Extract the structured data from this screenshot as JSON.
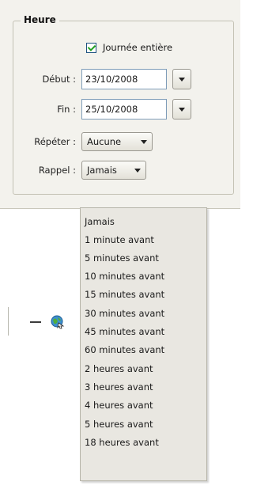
{
  "section": {
    "title": "Heure"
  },
  "all_day": {
    "label": "Journée entière",
    "checked": true
  },
  "start": {
    "label": "Début :",
    "value": "23/10/2008"
  },
  "end": {
    "label": "Fin :",
    "value": "25/10/2008"
  },
  "repeat": {
    "label": "Répéter :",
    "value": "Aucune"
  },
  "reminder": {
    "label": "Rappel :",
    "value": "Jamais",
    "options": [
      "Jamais",
      "1 minute avant",
      "5 minutes avant",
      "10 minutes avant",
      "15 minutes avant",
      "30 minutes avant",
      "45 minutes avant",
      "60 minutes avant",
      "2 heures avant",
      "3 heures avant",
      "4 heures avant",
      "5 heures avant",
      "18 heures avant"
    ]
  },
  "icons": {
    "toolbar_globe": "globe-arrow-icon",
    "toolbar_dash": "minus-icon"
  },
  "colors": {
    "panel_bg": "#f3f2ed",
    "checkmark": "#21a121",
    "dropdown_bg": "#e9e7e1"
  }
}
